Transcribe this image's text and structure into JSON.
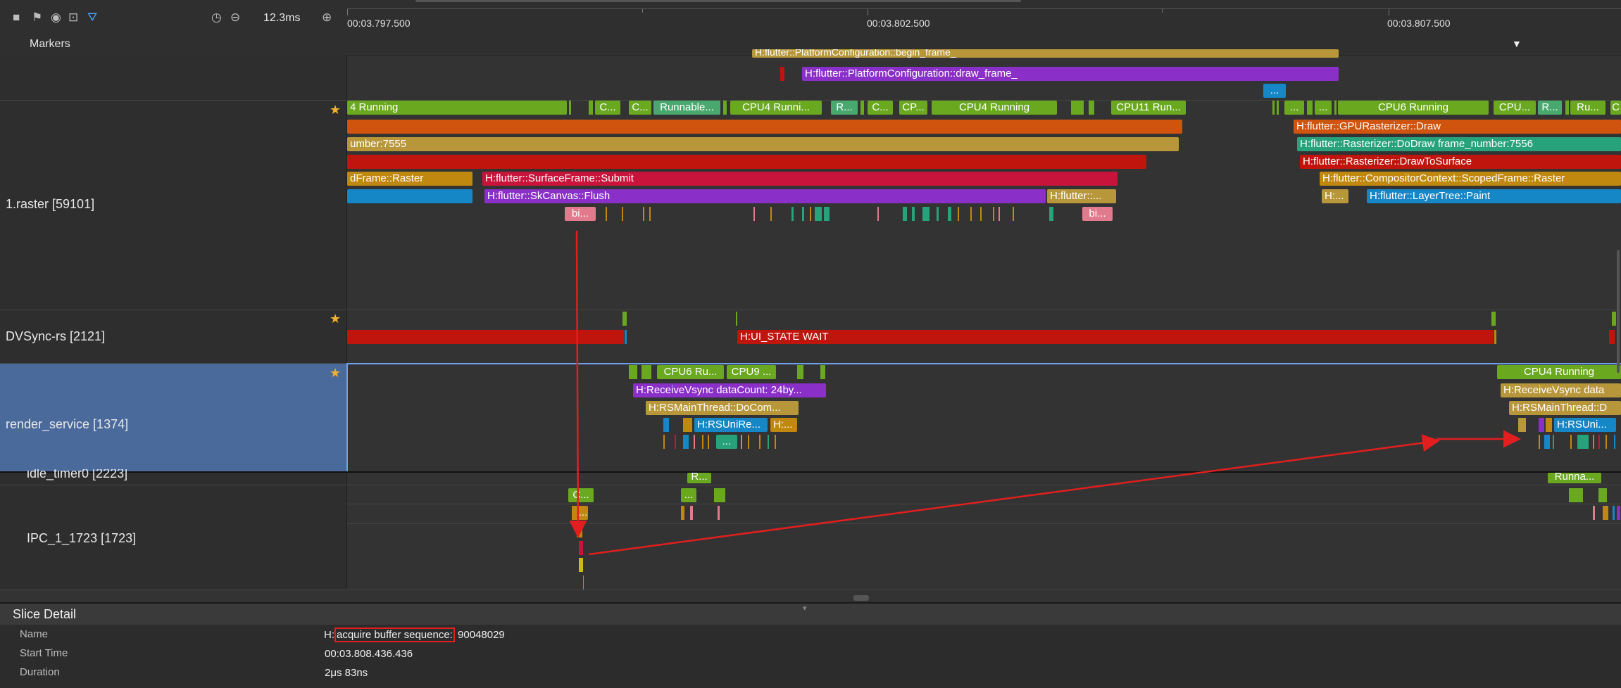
{
  "toolbar": {
    "icons": [
      "square-icon",
      "flag-icon",
      "palette-icon",
      "capture-icon",
      "filter-icon",
      "clock-icon",
      "zoom-out-icon",
      "zoom-in-icon"
    ],
    "range": "12.3ms"
  },
  "ruler": {
    "ticks": [
      "00:03.797.500",
      "00:03.802.500",
      "00:03.807.500"
    ]
  },
  "markers": {
    "label": "Markers"
  },
  "rows": {
    "raster": "1.raster [59101]",
    "dvsync": "DVSync-rs [2121]",
    "render_service": "render_service [1374]",
    "idle_timer": "idle_timer0 [2223]",
    "ipc": "IPC_1_1723 [1723]"
  },
  "slices": {
    "top_begin": "H:flutter::PlatformConfiguration::begin_frame_",
    "top_draw": "H:flutter::PlatformConfiguration::draw_frame_",
    "top_dots": "...",
    "r_running1": "4 Running",
    "r_c1": "C...",
    "r_c2": "C...",
    "r_runnable": "Runnable...",
    "r_cpu4a": "CPU4 Runni...",
    "r_r": "R...",
    "r_c3": "C...",
    "r_cp": "CP...",
    "r_cpu4b": "CPU4 Running",
    "r_cpu11": "CPU11 Run...",
    "r_d1": "...",
    "r_d2": "...",
    "r_cpu6": "CPU6 Running",
    "r_cpu_more": "CPU...",
    "r_r2": "R...",
    "r_ru": "Ru...",
    "r_c4": "C",
    "r_number": "umber:7555",
    "r_gpu": "H:flutter::GPURasterizer::Draw",
    "r_dodraw": "H:flutter::Rasterizer::DoDraw frame_number:7556",
    "r_drawsurface": "H:flutter::Rasterizer::DrawToSurface",
    "r_raster": "dFrame::Raster",
    "r_submit": "H:flutter::SurfaceFrame::Submit",
    "r_scoped": "H:flutter::CompositorContext::ScopedFrame::Raster",
    "r_flush": "H:flutter::SkCanvas::Flush",
    "r_flutter": "H:flutter::...",
    "r_h": "H:...",
    "r_paint": "H:flutter::LayerTree::Paint",
    "r_bi1": "bi...",
    "r_bi2": "bi...",
    "dv_wait": "H:UI_STATE WAIT",
    "rs_cpu6": "CPU6 Ru...",
    "rs_cpu9": "CPU9 ...",
    "rs_cpu4": "CPU4 Running",
    "rs_recv1": "H:ReceiveVsync dataCount: 24by...",
    "rs_recv2": "H:ReceiveVsync data",
    "rs_main1": "H:RSMainThread::DoCom...",
    "rs_main2": "H:RSMainThread::D",
    "rs_uni1": "H:RSUniRe...",
    "rs_h": "H:...",
    "rs_uni2": "H:RSUni...",
    "rs_dots": "...",
    "idle_r": "R...",
    "idle_running": "Runna...",
    "ipc_c": "C...",
    "ipc_d1": "...",
    "ipc_d2": "..."
  },
  "detail": {
    "title": "Slice Detail",
    "name_label": "Name",
    "name_prefix": "H:",
    "name_highlight": "acquire buffer sequence:",
    "name_suffix": " 90048029",
    "start_label": "Start Time",
    "start_value": "00:03.808.436.436",
    "duration_label": "Duration",
    "duration_value": "2μs 83ns"
  },
  "colors": {
    "running_green": "#6aa820",
    "olive": "#b8973a",
    "purple": "#8a2fc8",
    "red": "#c0150d",
    "orange": "#d0540e",
    "crimson": "#c8143a",
    "teal": "#27a27a",
    "blue": "#1687c6",
    "pink": "#e07a8c",
    "arrow": "#e21e1e",
    "selected": "#4a6a9c"
  }
}
